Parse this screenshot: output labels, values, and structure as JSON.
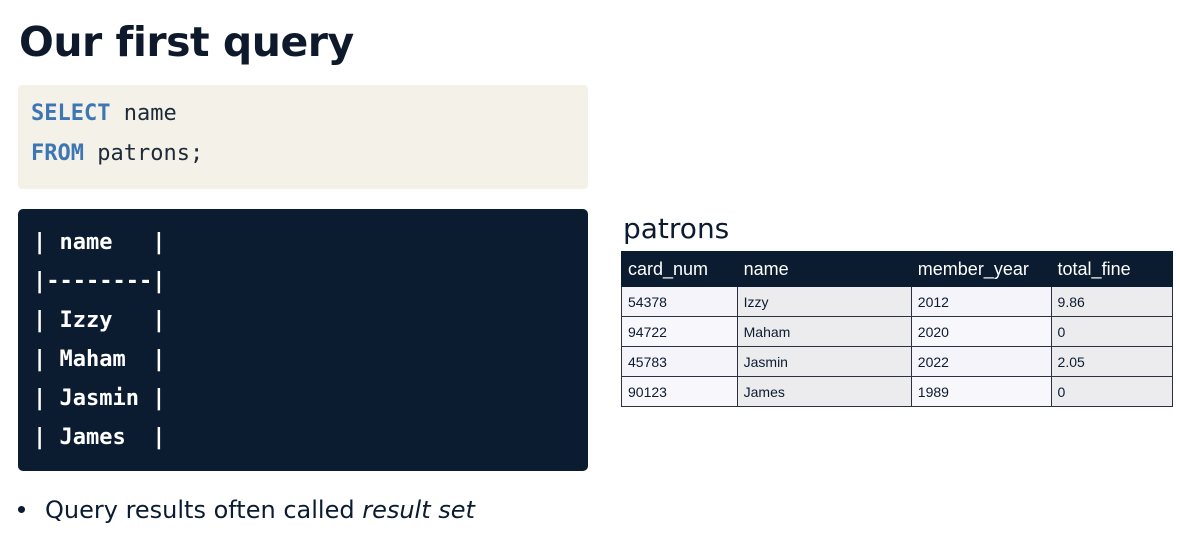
{
  "title": "Our first query",
  "code": {
    "line1_keyword": "SELECT",
    "line1_rest": " name",
    "line2_keyword": "FROM",
    "line2_rest": " patrons;"
  },
  "result": {
    "lines": [
      "| name   |",
      "|--------|",
      "| Izzy   |",
      "| Maham  |",
      "| Jasmin |",
      "| James  |"
    ]
  },
  "table": {
    "caption": "patrons",
    "headers": [
      "card_num",
      "name",
      "member_year",
      "total_fine"
    ],
    "rows": [
      [
        "54378",
        "Izzy",
        "2012",
        "9.86"
      ],
      [
        "94722",
        "Maham",
        "2020",
        "0"
      ],
      [
        "45783",
        "Jasmin",
        "2022",
        "2.05"
      ],
      [
        "90123",
        "James",
        "1989",
        "0"
      ]
    ]
  },
  "bullet": {
    "text": "Query results often called ",
    "emphasis": "result set"
  }
}
